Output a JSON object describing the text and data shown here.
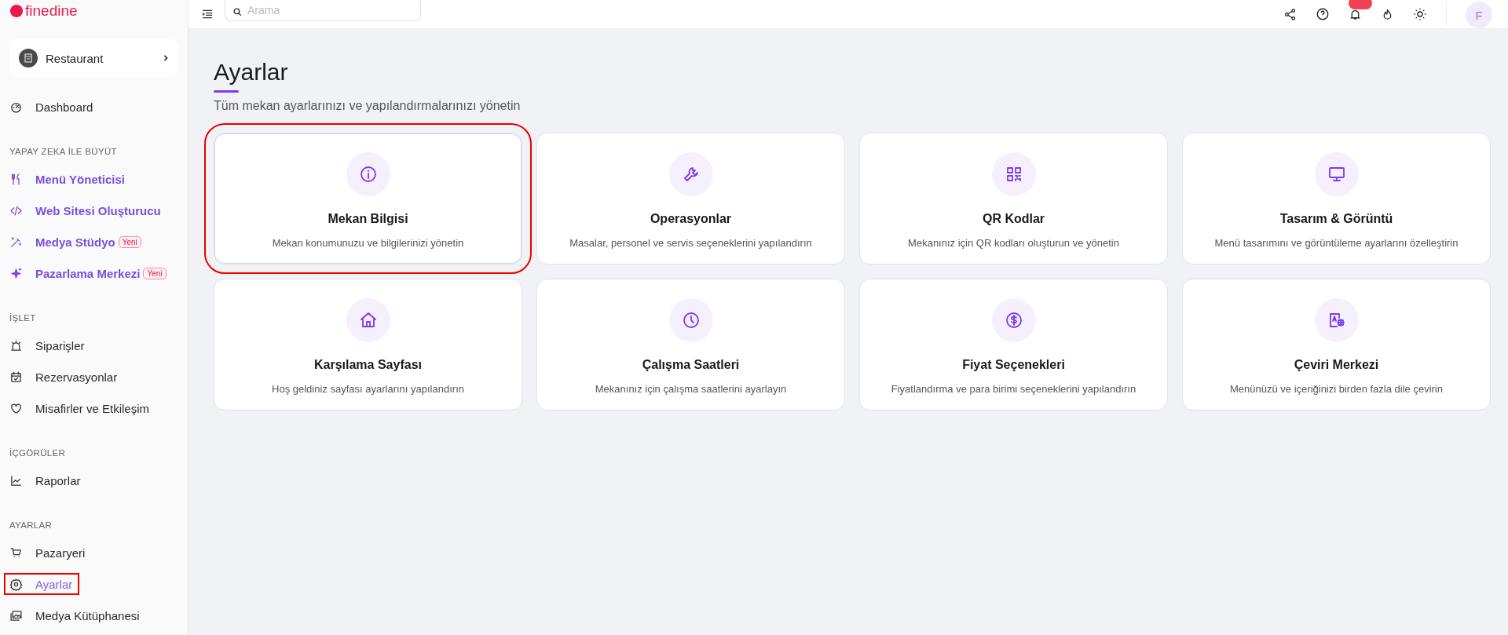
{
  "logo": {
    "text": "finedine"
  },
  "venue_switcher": {
    "label": "Restaurant"
  },
  "sidebar": {
    "sections": [
      {
        "items": [
          {
            "label": "Dashboard",
            "kind": "standard",
            "selected": false,
            "highlighted": false
          }
        ]
      },
      {
        "heading": "YAPAY ZEKA İLE BÜYÜT",
        "items": [
          {
            "label": "Menü Yöneticisi",
            "kind": "ai",
            "selected": false,
            "highlighted": false
          },
          {
            "label": "Web Sitesi Oluşturucu",
            "kind": "ai",
            "selected": false,
            "highlighted": false
          },
          {
            "label": "Medya Stüdyo",
            "kind": "ai",
            "selected": false,
            "highlighted": false,
            "badge": "Yeni"
          },
          {
            "label": "Pazarlama Merkezi",
            "kind": "ai",
            "selected": false,
            "highlighted": false,
            "badge": "Yeni"
          }
        ]
      },
      {
        "heading": "İŞLET",
        "items": [
          {
            "label": "Siparişler",
            "kind": "standard",
            "selected": false,
            "highlighted": false
          },
          {
            "label": "Rezervasyonlar",
            "kind": "standard",
            "selected": false,
            "highlighted": false
          },
          {
            "label": "Misafirler ve Etkileşim",
            "kind": "standard",
            "selected": false,
            "highlighted": false
          }
        ]
      },
      {
        "heading": "İÇGÖRÜLER",
        "items": [
          {
            "label": "Raporlar",
            "kind": "standard",
            "selected": false,
            "highlighted": false
          }
        ]
      },
      {
        "heading": "AYARLAR",
        "items": [
          {
            "label": "Pazaryeri",
            "kind": "standard",
            "selected": false,
            "highlighted": false
          },
          {
            "label": "Ayarlar",
            "kind": "standard",
            "selected": true,
            "highlighted": true
          },
          {
            "label": "Medya Kütüphanesi",
            "kind": "standard",
            "selected": false,
            "highlighted": false
          }
        ]
      }
    ]
  },
  "topbar": {
    "search": {
      "placeholder": "Arama"
    },
    "avatar": {
      "initial": "F"
    },
    "notifications": {
      "has_badge": true
    }
  },
  "page": {
    "title": "Ayarlar",
    "subtitle": "Tüm mekan ayarlarınızı ve yapılandırmalarınızı yönetin"
  },
  "cards": [
    {
      "title": "Mekan Bilgisi",
      "description": "Mekan konumunuzu ve bilgilerinizi yönetin",
      "highlighted": true
    },
    {
      "title": "Operasyonlar",
      "description": "Masalar, personel ve servis seçeneklerini yapılandırın",
      "highlighted": false
    },
    {
      "title": "QR Kodlar",
      "description": "Mekanınız için QR kodları oluşturun ve yönetin",
      "highlighted": false
    },
    {
      "title": "Tasarım & Görüntü",
      "description": "Menü tasarımını ve görüntüleme ayarlarını özelleştirin",
      "highlighted": false
    },
    {
      "title": "Karşılama Sayfası",
      "description": "Hoş geldiniz sayfası ayarlarını yapılandırın",
      "highlighted": false
    },
    {
      "title": "Çalışma Saatleri",
      "description": "Mekanınız için çalışma saatlerini ayarlayın",
      "highlighted": false
    },
    {
      "title": "Fiyat Seçenekleri",
      "description": "Fiyatlandırma ve para birimi seçeneklerini yapılandırın",
      "highlighted": false
    },
    {
      "title": "Çeviri Merkezi",
      "description": "Menünüzü ve içeriğinizi birden fazla dile çevirin",
      "highlighted": false
    }
  ]
}
